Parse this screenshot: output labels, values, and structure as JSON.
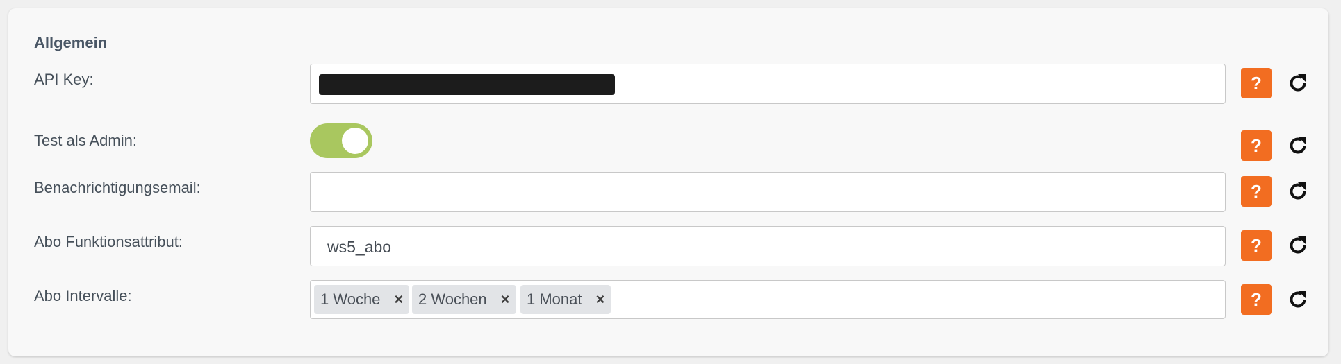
{
  "section": {
    "title": "Allgemein"
  },
  "fields": {
    "api_key": {
      "label": "API Key:",
      "value": ""
    },
    "test_admin": {
      "label": "Test als Admin:",
      "enabled": true
    },
    "notification_email": {
      "label": "Benachrichtigungsemail:",
      "value": ""
    },
    "abo_attribute": {
      "label": "Abo Funktionsattribut:",
      "value": "ws5_abo"
    },
    "abo_intervals": {
      "label": "Abo Intervalle:",
      "tags": [
        {
          "label": "1 Woche",
          "remove": "×"
        },
        {
          "label": "2 Wochen",
          "remove": "×"
        },
        {
          "label": "1 Monat",
          "remove": "×"
        }
      ]
    }
  },
  "buttons": {
    "help_label": "?",
    "help_icon": "question-mark",
    "reset_icon": "reload-icon"
  },
  "colors": {
    "accent_orange": "#f26d21",
    "toggle_on": "#a9c75f"
  }
}
